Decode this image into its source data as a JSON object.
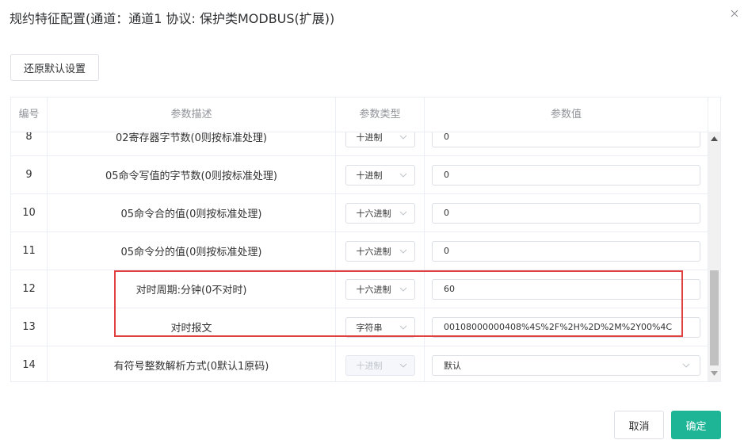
{
  "dialog": {
    "title": "规约特征配置(通道：通道1 协议: 保护类MODBUS(扩展))",
    "restore_label": "还原默认设置",
    "cancel_label": "取消",
    "confirm_label": "确定"
  },
  "table": {
    "headers": [
      "编号",
      "参数描述",
      "参数类型",
      "参数值"
    ],
    "rows": [
      {
        "no": "8",
        "desc": "02寄存器字节数(0则按标准处理)",
        "type": "十进制",
        "value": "0",
        "value_is_select": false,
        "type_disabled": false
      },
      {
        "no": "9",
        "desc": "05命令写值的字节数(0则按标准处理)",
        "type": "十进制",
        "value": "0",
        "value_is_select": false,
        "type_disabled": false
      },
      {
        "no": "10",
        "desc": "05命令合的值(0则按标准处理)",
        "type": "十六进制",
        "value": "0",
        "value_is_select": false,
        "type_disabled": false
      },
      {
        "no": "11",
        "desc": "05命令分的值(0则按标准处理)",
        "type": "十六进制",
        "value": "0",
        "value_is_select": false,
        "type_disabled": false
      },
      {
        "no": "12",
        "desc": "对时周期:分钟(0不对时)",
        "type": "十六进制",
        "value": "60",
        "value_is_select": false,
        "type_disabled": false
      },
      {
        "no": "13",
        "desc": "对时报文",
        "type": "字符串",
        "value": "00108000000408%4S%2F%2H%2D%2M%2Y00%4C",
        "value_is_select": false,
        "type_disabled": false
      },
      {
        "no": "14",
        "desc": "有符号整数解析方式(0默认1原码)",
        "type": "十进制",
        "value": "默认",
        "value_is_select": true,
        "type_disabled": true
      }
    ]
  },
  "colors": {
    "accent": "#1db596",
    "highlight": "#e0403f"
  },
  "icons": {
    "close": "close-icon",
    "dropdown": "chevron-down-icon",
    "scroll_up": "scroll-up-arrow-icon",
    "scroll_down": "scroll-down-arrow-icon"
  }
}
